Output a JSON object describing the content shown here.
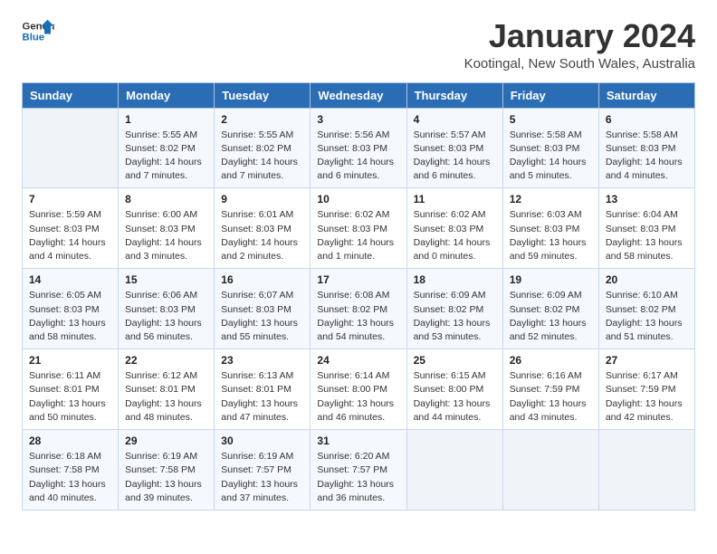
{
  "header": {
    "logo_line1": "General",
    "logo_line2": "Blue",
    "month_title": "January 2024",
    "subtitle": "Kootingal, New South Wales, Australia"
  },
  "weekdays": [
    "Sunday",
    "Monday",
    "Tuesday",
    "Wednesday",
    "Thursday",
    "Friday",
    "Saturday"
  ],
  "weeks": [
    [
      {
        "day": "",
        "info": ""
      },
      {
        "day": "1",
        "info": "Sunrise: 5:55 AM\nSunset: 8:02 PM\nDaylight: 14 hours\nand 7 minutes."
      },
      {
        "day": "2",
        "info": "Sunrise: 5:55 AM\nSunset: 8:02 PM\nDaylight: 14 hours\nand 7 minutes."
      },
      {
        "day": "3",
        "info": "Sunrise: 5:56 AM\nSunset: 8:03 PM\nDaylight: 14 hours\nand 6 minutes."
      },
      {
        "day": "4",
        "info": "Sunrise: 5:57 AM\nSunset: 8:03 PM\nDaylight: 14 hours\nand 6 minutes."
      },
      {
        "day": "5",
        "info": "Sunrise: 5:58 AM\nSunset: 8:03 PM\nDaylight: 14 hours\nand 5 minutes."
      },
      {
        "day": "6",
        "info": "Sunrise: 5:58 AM\nSunset: 8:03 PM\nDaylight: 14 hours\nand 4 minutes."
      }
    ],
    [
      {
        "day": "7",
        "info": "Sunrise: 5:59 AM\nSunset: 8:03 PM\nDaylight: 14 hours\nand 4 minutes."
      },
      {
        "day": "8",
        "info": "Sunrise: 6:00 AM\nSunset: 8:03 PM\nDaylight: 14 hours\nand 3 minutes."
      },
      {
        "day": "9",
        "info": "Sunrise: 6:01 AM\nSunset: 8:03 PM\nDaylight: 14 hours\nand 2 minutes."
      },
      {
        "day": "10",
        "info": "Sunrise: 6:02 AM\nSunset: 8:03 PM\nDaylight: 14 hours\nand 1 minute."
      },
      {
        "day": "11",
        "info": "Sunrise: 6:02 AM\nSunset: 8:03 PM\nDaylight: 14 hours\nand 0 minutes."
      },
      {
        "day": "12",
        "info": "Sunrise: 6:03 AM\nSunset: 8:03 PM\nDaylight: 13 hours\nand 59 minutes."
      },
      {
        "day": "13",
        "info": "Sunrise: 6:04 AM\nSunset: 8:03 PM\nDaylight: 13 hours\nand 58 minutes."
      }
    ],
    [
      {
        "day": "14",
        "info": "Sunrise: 6:05 AM\nSunset: 8:03 PM\nDaylight: 13 hours\nand 58 minutes."
      },
      {
        "day": "15",
        "info": "Sunrise: 6:06 AM\nSunset: 8:03 PM\nDaylight: 13 hours\nand 56 minutes."
      },
      {
        "day": "16",
        "info": "Sunrise: 6:07 AM\nSunset: 8:03 PM\nDaylight: 13 hours\nand 55 minutes."
      },
      {
        "day": "17",
        "info": "Sunrise: 6:08 AM\nSunset: 8:02 PM\nDaylight: 13 hours\nand 54 minutes."
      },
      {
        "day": "18",
        "info": "Sunrise: 6:09 AM\nSunset: 8:02 PM\nDaylight: 13 hours\nand 53 minutes."
      },
      {
        "day": "19",
        "info": "Sunrise: 6:09 AM\nSunset: 8:02 PM\nDaylight: 13 hours\nand 52 minutes."
      },
      {
        "day": "20",
        "info": "Sunrise: 6:10 AM\nSunset: 8:02 PM\nDaylight: 13 hours\nand 51 minutes."
      }
    ],
    [
      {
        "day": "21",
        "info": "Sunrise: 6:11 AM\nSunset: 8:01 PM\nDaylight: 13 hours\nand 50 minutes."
      },
      {
        "day": "22",
        "info": "Sunrise: 6:12 AM\nSunset: 8:01 PM\nDaylight: 13 hours\nand 48 minutes."
      },
      {
        "day": "23",
        "info": "Sunrise: 6:13 AM\nSunset: 8:01 PM\nDaylight: 13 hours\nand 47 minutes."
      },
      {
        "day": "24",
        "info": "Sunrise: 6:14 AM\nSunset: 8:00 PM\nDaylight: 13 hours\nand 46 minutes."
      },
      {
        "day": "25",
        "info": "Sunrise: 6:15 AM\nSunset: 8:00 PM\nDaylight: 13 hours\nand 44 minutes."
      },
      {
        "day": "26",
        "info": "Sunrise: 6:16 AM\nSunset: 7:59 PM\nDaylight: 13 hours\nand 43 minutes."
      },
      {
        "day": "27",
        "info": "Sunrise: 6:17 AM\nSunset: 7:59 PM\nDaylight: 13 hours\nand 42 minutes."
      }
    ],
    [
      {
        "day": "28",
        "info": "Sunrise: 6:18 AM\nSunset: 7:58 PM\nDaylight: 13 hours\nand 40 minutes."
      },
      {
        "day": "29",
        "info": "Sunrise: 6:19 AM\nSunset: 7:58 PM\nDaylight: 13 hours\nand 39 minutes."
      },
      {
        "day": "30",
        "info": "Sunrise: 6:19 AM\nSunset: 7:57 PM\nDaylight: 13 hours\nand 37 minutes."
      },
      {
        "day": "31",
        "info": "Sunrise: 6:20 AM\nSunset: 7:57 PM\nDaylight: 13 hours\nand 36 minutes."
      },
      {
        "day": "",
        "info": ""
      },
      {
        "day": "",
        "info": ""
      },
      {
        "day": "",
        "info": ""
      }
    ]
  ]
}
